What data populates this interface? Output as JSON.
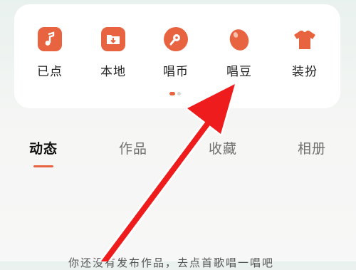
{
  "quick_actions": [
    {
      "label": "已点",
      "icon": "music-note-icon"
    },
    {
      "label": "本地",
      "icon": "folder-download-icon"
    },
    {
      "label": "唱币",
      "icon": "coin-icon"
    },
    {
      "label": "唱豆",
      "icon": "bean-icon"
    },
    {
      "label": "装扮",
      "icon": "tshirt-icon"
    }
  ],
  "tabs": [
    {
      "label": "动态",
      "active": true
    },
    {
      "label": "作品",
      "active": false
    },
    {
      "label": "收藏",
      "active": false
    },
    {
      "label": "相册",
      "active": false
    }
  ],
  "bottom_text": "你还没有发布作品，去点首歌唱一唱吧",
  "colors": {
    "accent": "#e8633f",
    "annotation_arrow": "#ee1c1c"
  }
}
